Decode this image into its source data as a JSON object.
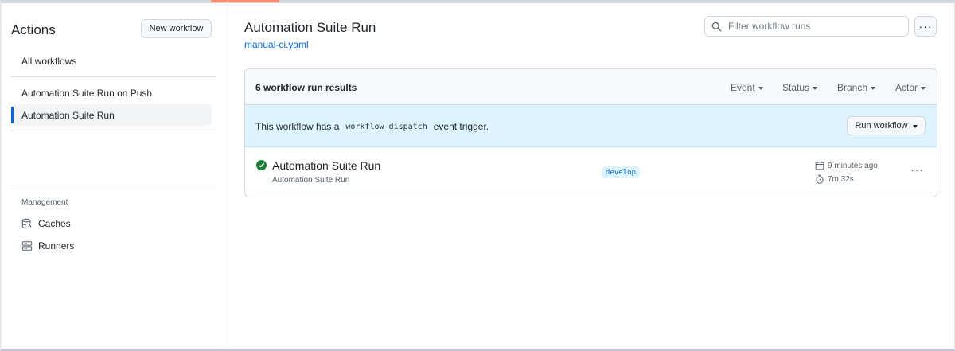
{
  "sidebar": {
    "title": "Actions",
    "new_workflow_label": "New workflow",
    "all_workflows_label": "All workflows",
    "workflows": [
      {
        "label": "Automation Suite Run on Push"
      },
      {
        "label": "Automation Suite Run",
        "active": true
      }
    ],
    "management_heading": "Management",
    "management_items": [
      {
        "label": "Caches",
        "icon": "database-icon"
      },
      {
        "label": "Runners",
        "icon": "server-icon"
      }
    ]
  },
  "main": {
    "title": "Automation Suite Run",
    "workflow_file": "manual-ci.yaml",
    "filter_placeholder": "Filter workflow runs",
    "more_label": "···",
    "results_count": "6 workflow run results",
    "filters": [
      {
        "label": "Event"
      },
      {
        "label": "Status"
      },
      {
        "label": "Branch"
      },
      {
        "label": "Actor"
      }
    ],
    "banner": {
      "prefix": "This workflow has a",
      "code": "workflow_dispatch",
      "suffix": "event trigger.",
      "button_label": "Run workflow"
    },
    "runs": [
      {
        "title": "Automation Suite Run",
        "subtitle": "Automation Suite Run",
        "branch": "develop",
        "time_ago": "9 minutes ago",
        "duration": "7m 32s",
        "status": "success",
        "more_label": "···"
      }
    ]
  },
  "colors": {
    "accent_blue": "#0969da",
    "success_green": "#1a7f37",
    "banner_bg": "#ddf4ff",
    "tab_underline": "#fd8c73"
  }
}
